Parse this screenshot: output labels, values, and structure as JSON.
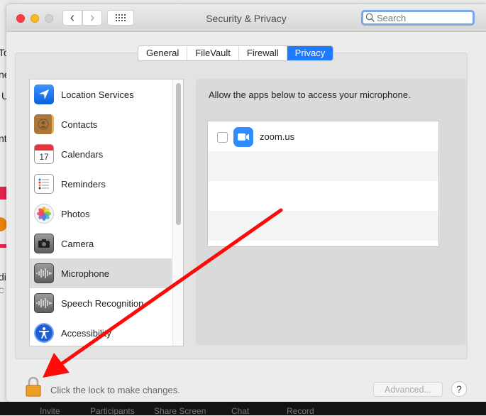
{
  "background": {
    "left_fragments": [
      "To",
      "ne",
      "U",
      "nt",
      "dic",
      "C"
    ],
    "bottom_toolbar": [
      "Invite",
      "Participants",
      "Share Screen",
      "Chat",
      "Record"
    ]
  },
  "window": {
    "title": "Security & Privacy",
    "nav": {
      "back_glyph": "‹",
      "forward_glyph": "›",
      "grid_glyph": "⋮⋮⋮"
    },
    "search": {
      "placeholder": "Search",
      "value": "",
      "icon": "magnifier-icon"
    }
  },
  "tabs": [
    {
      "label": "General",
      "active": false
    },
    {
      "label": "FileVault",
      "active": false
    },
    {
      "label": "Firewall",
      "active": false
    },
    {
      "label": "Privacy",
      "active": true
    }
  ],
  "services": [
    {
      "label": "Location Services",
      "icon": "location-arrow-icon",
      "color": "#1a73f0",
      "selected": false
    },
    {
      "label": "Contacts",
      "icon": "contacts-book-icon",
      "color": "#a9763b",
      "selected": false
    },
    {
      "label": "Calendars",
      "icon": "calendar-icon",
      "color": "#ffffff",
      "badge": "17",
      "selected": false
    },
    {
      "label": "Reminders",
      "icon": "reminders-list-icon",
      "color": "#ffffff",
      "selected": false
    },
    {
      "label": "Photos",
      "icon": "photos-flower-icon",
      "color": "#ffffff",
      "selected": false
    },
    {
      "label": "Camera",
      "icon": "camera-icon",
      "color": "#707070",
      "selected": false
    },
    {
      "label": "Microphone",
      "icon": "microphone-waveform-icon",
      "color": "#707070",
      "selected": true
    },
    {
      "label": "Speech Recognition",
      "icon": "speech-waveform-icon",
      "color": "#707070",
      "selected": false
    },
    {
      "label": "Accessibility",
      "icon": "accessibility-person-icon",
      "color": "#1a5fd6",
      "selected": false
    }
  ],
  "detail": {
    "description": "Allow the apps below to access your microphone.",
    "apps": [
      {
        "name": "zoom.us",
        "checked": false,
        "icon": "zoom-camera-icon",
        "color": "#2d8cff"
      }
    ]
  },
  "footer": {
    "lock_text": "Click the lock to make changes.",
    "advanced_label": "Advanced...",
    "help_label": "?"
  },
  "annotation": {
    "type": "arrow",
    "color": "#ff0000",
    "target": "lock-icon"
  }
}
